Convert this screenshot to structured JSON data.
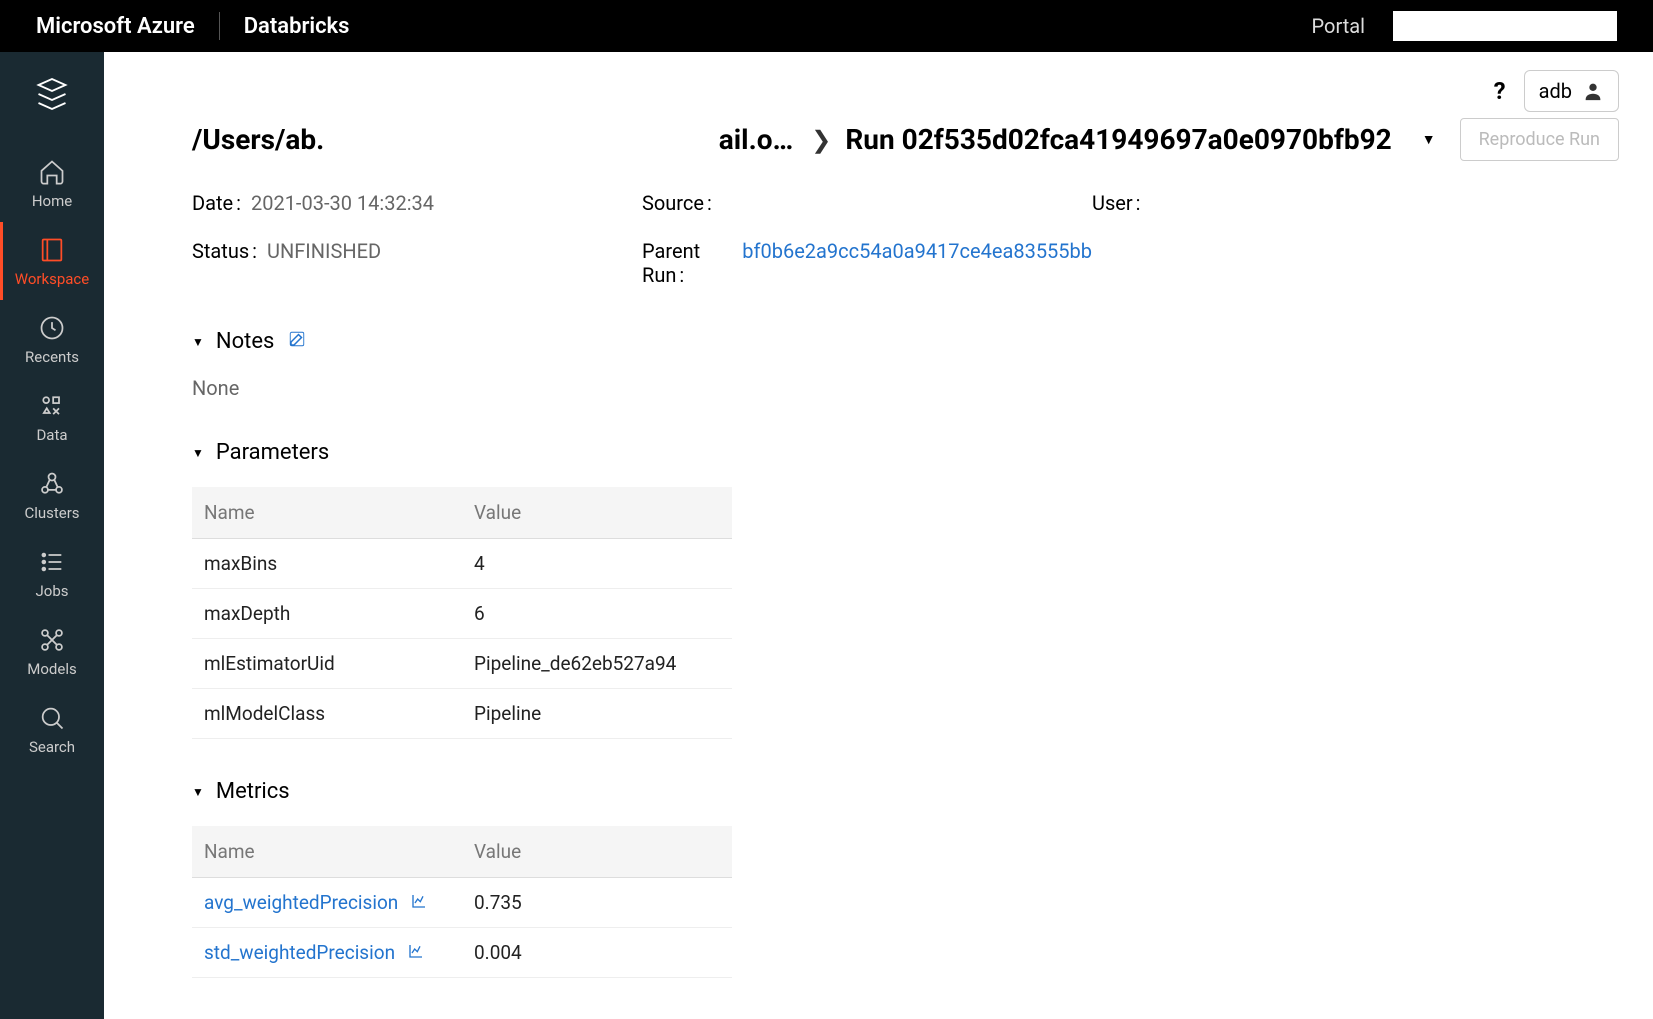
{
  "topbar": {
    "brand1": "Microsoft Azure",
    "brand2": "Databricks",
    "portal": "Portal"
  },
  "sidebar": {
    "items": [
      {
        "label": "Home"
      },
      {
        "label": "Workspace"
      },
      {
        "label": "Recents"
      },
      {
        "label": "Data"
      },
      {
        "label": "Clusters"
      },
      {
        "label": "Jobs"
      },
      {
        "label": "Models"
      },
      {
        "label": "Search"
      }
    ]
  },
  "header": {
    "user_label": "adb"
  },
  "breadcrumb": {
    "path_left": "/Users/ab.",
    "path_right": "ail.o…",
    "run_label": "Run 02f535d02fca41949697a0e0970bfb92",
    "reproduce_label": "Reproduce Run"
  },
  "meta": {
    "date_label": "Date",
    "date_value": "2021-03-30 14:32:34",
    "source_label": "Source",
    "source_value": "",
    "user_label": "User",
    "user_value": "",
    "status_label": "Status",
    "status_value": "UNFINISHED",
    "parent_label": "Parent Run",
    "parent_value": "bf0b6e2a9cc54a0a9417ce4ea83555bb"
  },
  "notes": {
    "title": "Notes",
    "body": "None"
  },
  "parameters": {
    "title": "Parameters",
    "columns": {
      "name": "Name",
      "value": "Value"
    },
    "rows": [
      {
        "name": "maxBins",
        "value": "4"
      },
      {
        "name": "maxDepth",
        "value": "6"
      },
      {
        "name": "mlEstimatorUid",
        "value": "Pipeline_de62eb527a94"
      },
      {
        "name": "mlModelClass",
        "value": "Pipeline"
      }
    ]
  },
  "metrics": {
    "title": "Metrics",
    "columns": {
      "name": "Name",
      "value": "Value"
    },
    "rows": [
      {
        "name": "avg_weightedPrecision",
        "value": "0.735"
      },
      {
        "name": "std_weightedPrecision",
        "value": "0.004"
      }
    ]
  }
}
